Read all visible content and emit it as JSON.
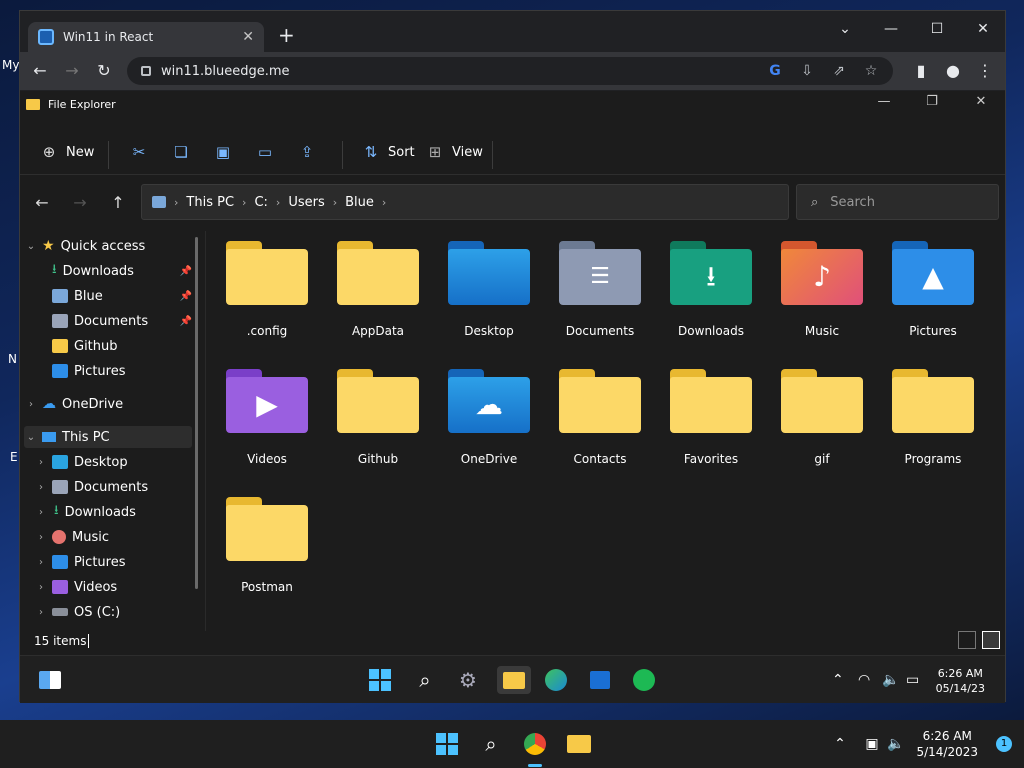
{
  "desktop": {
    "labels": [
      "My",
      "N",
      "E"
    ]
  },
  "browser": {
    "tab_title": "Win11 in React",
    "new_tab": "+",
    "url": "win11.blueedge.me",
    "controls": {
      "minimize": "⌄",
      "restore": "–",
      "maximize": "☐",
      "close": "✕"
    }
  },
  "explorer": {
    "title": "File Explorer",
    "commands": {
      "new": "New",
      "sort": "Sort",
      "view": "View"
    },
    "breadcrumb": [
      "This PC",
      "C:",
      "Users",
      "Blue"
    ],
    "search_placeholder": "Search",
    "sidebar": {
      "quick_access": "Quick access",
      "quick_items": [
        "Downloads",
        "Blue",
        "Documents",
        "Github",
        "Pictures"
      ],
      "onedrive": "OneDrive",
      "this_pc": "This PC",
      "pc_items": [
        "Desktop",
        "Documents",
        "Downloads",
        "Music",
        "Pictures",
        "Videos",
        "OS (C:)"
      ]
    },
    "items": [
      ".config",
      "AppData",
      "Desktop",
      "Documents",
      "Downloads",
      "Music",
      "Pictures",
      "Videos",
      "Github",
      "OneDrive",
      "Contacts",
      "Favorites",
      "gif",
      "Programs",
      "Postman"
    ],
    "status": "15 items"
  },
  "inner_taskbar": {
    "time": "6:26 AM",
    "date": "05/14/23"
  },
  "outer_taskbar": {
    "time": "6:26 AM",
    "date": "5/14/2023",
    "badge": "1"
  }
}
